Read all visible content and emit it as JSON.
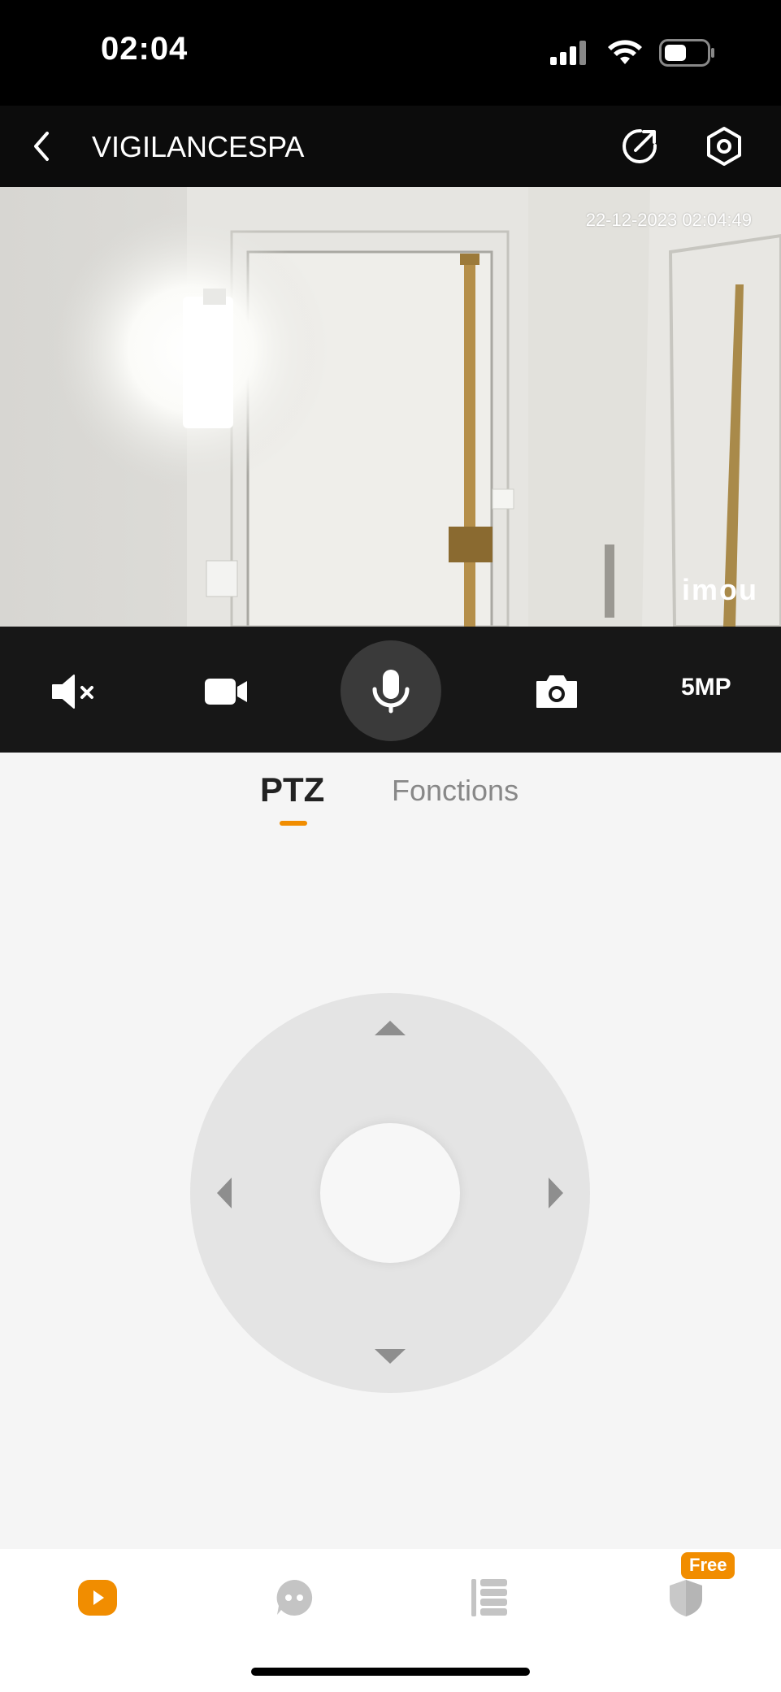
{
  "status_bar": {
    "time": "02:04",
    "icons": [
      "signal-icon",
      "wifi-icon",
      "battery-icon"
    ]
  },
  "header": {
    "title": "VIGILANCESPA",
    "back_icon": "chevron-left-icon",
    "share_icon": "share-icon",
    "settings_icon": "settings-icon"
  },
  "video": {
    "timestamp": "22-12-2023 02:04:49",
    "logo": "imou"
  },
  "controls": {
    "mute_icon": "speaker-muted-icon",
    "record_icon": "video-record-icon",
    "mic_icon": "microphone-icon",
    "snapshot_icon": "camera-icon",
    "resolution": "5MP"
  },
  "tabs": [
    {
      "label": "PTZ",
      "active": true
    },
    {
      "label": "Fonctions",
      "active": false
    }
  ],
  "ptz": {
    "directions": [
      "up",
      "down",
      "left",
      "right"
    ]
  },
  "bottom_nav": {
    "items": [
      {
        "icon": "play-icon",
        "active": true
      },
      {
        "icon": "chat-icon",
        "active": false
      },
      {
        "icon": "list-icon",
        "active": false
      },
      {
        "icon": "shield-icon",
        "active": false
      }
    ],
    "free_badge": "Free"
  },
  "colors": {
    "accent": "#f18d00",
    "header_bg": "#0c0c0c",
    "control_bg": "#171717",
    "page_bg": "#f5f5f5"
  }
}
